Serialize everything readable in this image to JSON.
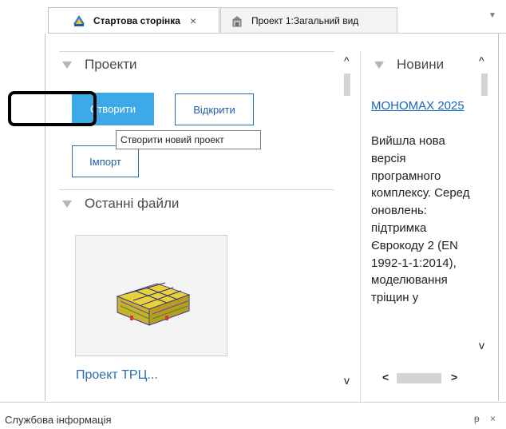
{
  "tabs": [
    {
      "label": "Стартова сторінка",
      "icon": "start-page-icon",
      "close": "×",
      "active": true
    },
    {
      "label": "Проект 1:Загальний вид",
      "icon": "building-icon",
      "active": false
    }
  ],
  "overflow_icon": "▼",
  "projects": {
    "header": "Проекти",
    "create_label": "Створити",
    "open_label": "Відкрити",
    "import_label": "Імпорт",
    "tooltip": "Створити новий проект"
  },
  "recent": {
    "header": "Останні файли",
    "file_caption": "Проект ТРЦ..."
  },
  "news": {
    "header": "Новини",
    "title": "МОНОМАХ 2025",
    "body": "Вийшла нова версія програмного комплексу. Серед оновлень: підтримка Єврокоду 2 (EN 1992-1-1:2014), моделювання тріщин у"
  },
  "scroll": {
    "up": "^",
    "down": "v",
    "left": "<",
    "right": ">"
  },
  "footer": {
    "title": "Службова інформація",
    "pin": "ᵽ",
    "close": "×"
  },
  "colors": {
    "accent": "#3da9e6",
    "link": "#1565c0",
    "highlight": "#000000"
  }
}
